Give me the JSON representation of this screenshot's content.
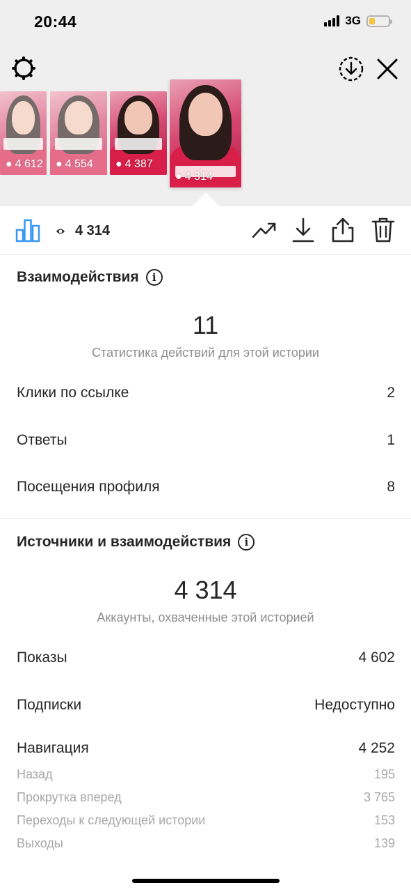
{
  "status_bar": {
    "time": "20:44",
    "network": "3G",
    "battery_level": 0.3
  },
  "stories": [
    {
      "views": "4 612"
    },
    {
      "views": "4 554"
    },
    {
      "views": "4 387"
    },
    {
      "views": "4 314"
    }
  ],
  "action_bar": {
    "views": "4 314"
  },
  "interactions": {
    "title": "Взаимодействия",
    "total": "11",
    "caption": "Статистика действий для этой истории",
    "rows": [
      {
        "label": "Клики по ссылке",
        "value": "2"
      },
      {
        "label": "Ответы",
        "value": "1"
      },
      {
        "label": "Посещения профиля",
        "value": "8"
      }
    ]
  },
  "reach": {
    "title": "Источники и взаимодействия",
    "total": "4 314",
    "caption": "Аккаунты, охваченные этой историей",
    "rows": [
      {
        "label": "Показы",
        "value": "4 602"
      },
      {
        "label": "Подписки",
        "value": "Недоступно"
      },
      {
        "label": "Навигация",
        "value": "4 252"
      }
    ],
    "navigation": [
      {
        "label": "Назад",
        "value": "195"
      },
      {
        "label": "Прокрутка вперед",
        "value": "3 765"
      },
      {
        "label": "Переходы к следующей истории",
        "value": "153"
      },
      {
        "label": "Выходы",
        "value": "139"
      }
    ]
  },
  "colors": {
    "accent": "#3897f0",
    "text": "#262626",
    "secondary": "#8e8e8e",
    "battery": "#f6c342"
  }
}
